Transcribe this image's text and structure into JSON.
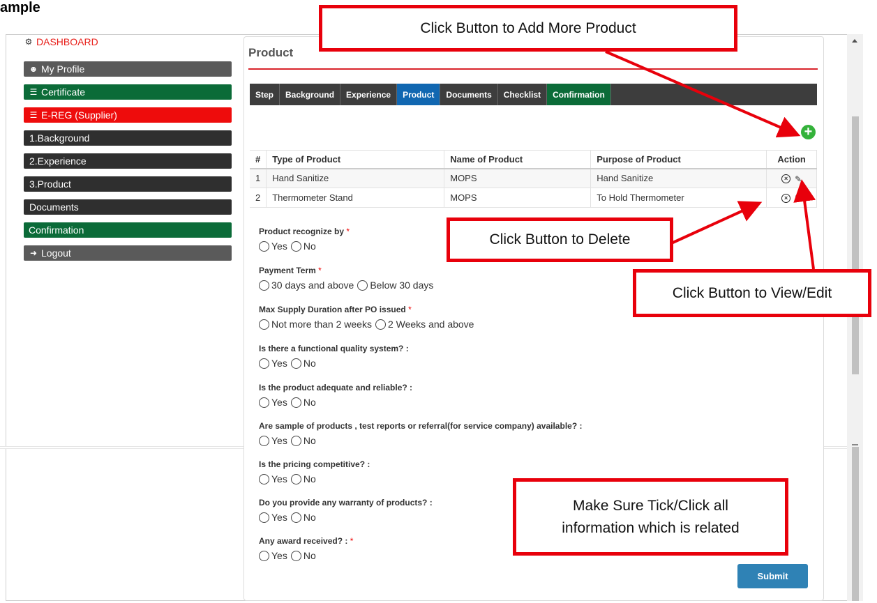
{
  "doc_title": "ample",
  "sidebar": {
    "dashboard": "DASHBOARD",
    "dashboard_icon": "dashboard-icon",
    "items": [
      {
        "label": "My Profile",
        "icon": "user-icon"
      },
      {
        "label": "Certificate",
        "icon": "list-icon"
      },
      {
        "label": "E-REG (Supplier)",
        "icon": "list-icon"
      },
      {
        "label": "1.Background"
      },
      {
        "label": "2.Experience"
      },
      {
        "label": "3.Product"
      },
      {
        "label": "Documents"
      },
      {
        "label": "Confirmation"
      },
      {
        "label": "Logout",
        "icon": "logout-icon"
      }
    ]
  },
  "main": {
    "title": "Product",
    "tabs": [
      {
        "label": "Step"
      },
      {
        "label": "Background"
      },
      {
        "label": "Experience"
      },
      {
        "label": "Product"
      },
      {
        "label": "Documents"
      },
      {
        "label": "Checklist"
      },
      {
        "label": "Confirmation"
      }
    ],
    "add_button_glyph": "+",
    "table": {
      "headers": [
        "#",
        "Type of Product",
        "Name of Product",
        "Purpose of Product",
        "Action"
      ],
      "rows": [
        {
          "no": "1",
          "type": "Hand Sanitize",
          "name": "MOPS",
          "purpose": "Hand Sanitize"
        },
        {
          "no": "2",
          "type": "Thermometer Stand",
          "name": "MOPS",
          "purpose": "To Hold Thermometer"
        }
      ]
    },
    "questions": [
      {
        "label": "Product recognize by",
        "required": "*",
        "options": [
          "Yes",
          "No"
        ]
      },
      {
        "label": "Payment Term",
        "required": "*",
        "options": [
          "30 days and above",
          "Below 30 days"
        ]
      },
      {
        "label": "Max Supply Duration after PO issued",
        "required": "*",
        "options": [
          "Not more than 2 weeks",
          "2 Weeks and above"
        ]
      },
      {
        "label": "Is there a functional quality system? :",
        "required": "",
        "options": [
          "Yes",
          "No"
        ]
      },
      {
        "label": "Is the product adequate and reliable? :",
        "required": "",
        "options": [
          "Yes",
          "No"
        ]
      },
      {
        "label": "Are sample of products , test reports or referral(for service company) available? :",
        "required": "",
        "options": [
          "Yes",
          "No"
        ]
      },
      {
        "label": "Is the pricing competitive? :",
        "required": "",
        "options": [
          "Yes",
          "No"
        ]
      },
      {
        "label": "Do you provide any warranty of products? :",
        "required": "",
        "options": [
          "Yes",
          "No"
        ]
      },
      {
        "label": "Any award received? :",
        "required": "*",
        "options": [
          "Yes",
          "No"
        ]
      }
    ],
    "submit_label": "Submit"
  },
  "callouts": {
    "add": "Click Button to Add More Product",
    "delete": "Click Button to Delete",
    "edit": "Click Button to View/Edit",
    "tick_line1": "Make Sure Tick/Click all",
    "tick_line2": "information which is related"
  },
  "colors": {
    "accent_red": "#e8000b",
    "sidebar_green": "#0b6b38",
    "tab_active_blue": "#1167b1",
    "submit_blue": "#2f82b5",
    "add_green": "#34b23a"
  }
}
